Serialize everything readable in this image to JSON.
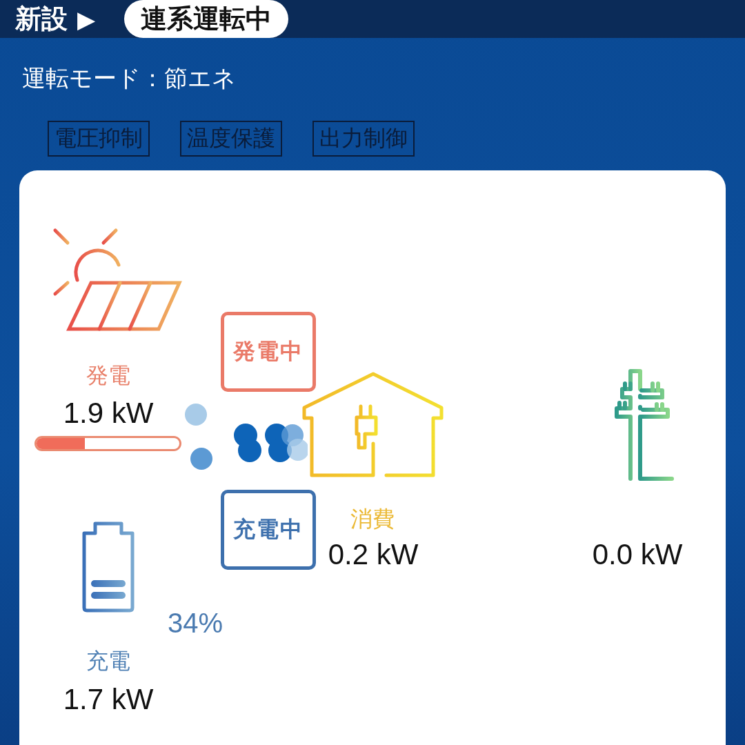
{
  "header": {
    "title": "新設",
    "arrow": "▶",
    "status": "連系運転中"
  },
  "mode": "運転モード：節エネ",
  "flags": [
    {
      "label": "電圧抑制",
      "active": false
    },
    {
      "label": "温度保護",
      "active": false
    },
    {
      "label": "出力制御",
      "active": false
    }
  ],
  "solar": {
    "label": "発電",
    "value": "1.9 kW",
    "level": 0.34
  },
  "status_boxes": [
    {
      "label": "発電中",
      "kind": "generating"
    },
    {
      "label": "充電中",
      "kind": "charging"
    }
  ],
  "house": {
    "label": "消費",
    "value": "0.2 kW"
  },
  "grid": {
    "value": "0.0 kW"
  },
  "battery": {
    "percent": "34%",
    "label": "充電",
    "value": "1.7 kW"
  }
}
